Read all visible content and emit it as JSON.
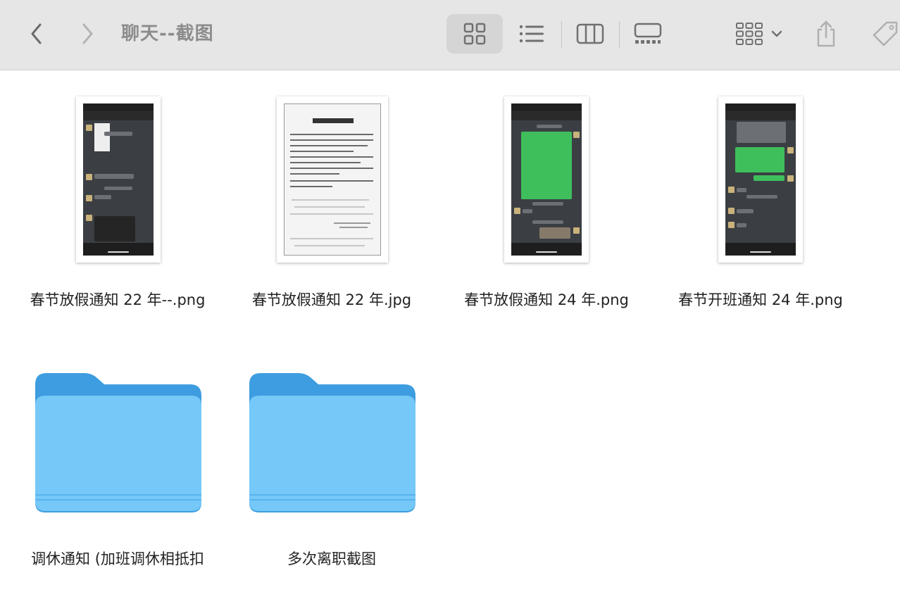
{
  "window": {
    "title": "聊天--截图"
  },
  "toolbar": {
    "back_icon": "chevron-left-icon",
    "forward_icon": "chevron-right-icon",
    "views": [
      {
        "name": "icon-view",
        "selected": true
      },
      {
        "name": "list-view",
        "selected": false
      },
      {
        "name": "column-view",
        "selected": false
      },
      {
        "name": "gallery-view",
        "selected": false
      }
    ],
    "group_icon": "group-grid-icon",
    "share_icon": "share-icon",
    "tag_icon": "tag-icon"
  },
  "files": [
    {
      "name": "春节放假通知 22 年--.png",
      "kind": "phone-screenshot"
    },
    {
      "name": "春节放假通知 22 年.jpg",
      "kind": "document-scan"
    },
    {
      "name": "春节放假通知 24 年.png",
      "kind": "phone-screenshot"
    },
    {
      "name": "春节开班通知 24 年.png",
      "kind": "phone-screenshot"
    }
  ],
  "folders": [
    {
      "name": "调休通知 (加班调休相抵扣"
    },
    {
      "name": "多次离职截图"
    }
  ],
  "colors": {
    "toolbar_bg": "#e6e6e6",
    "folder_light": "#75c8f7",
    "folder_dark": "#3d9de0",
    "chat_green": "#3fbf5c"
  }
}
